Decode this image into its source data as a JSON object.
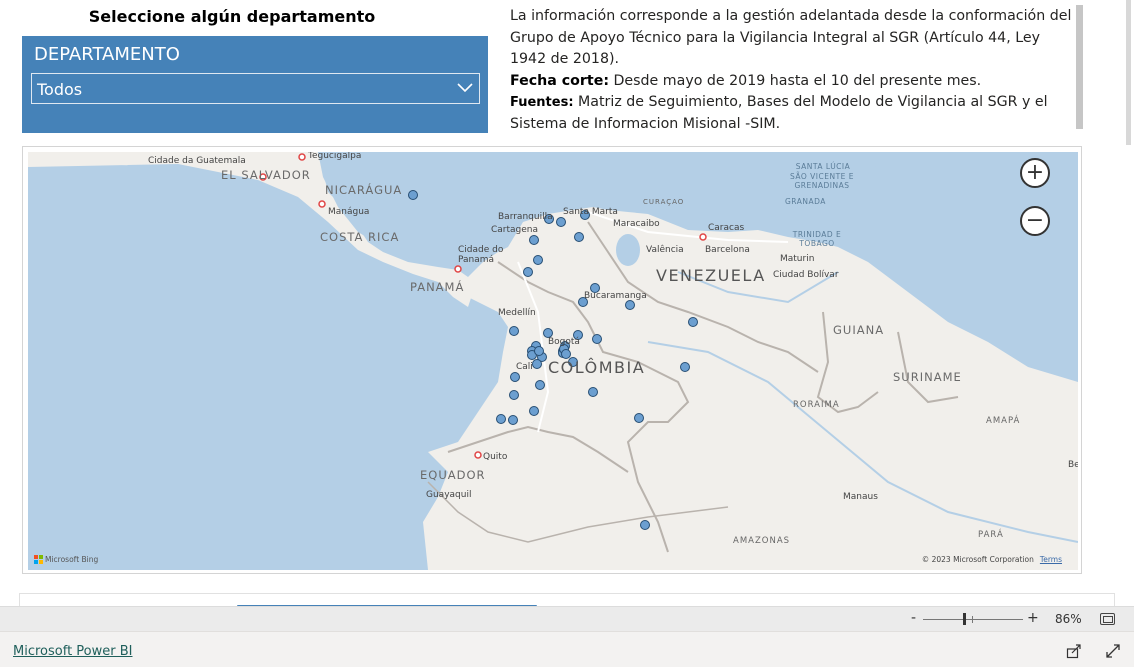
{
  "slicer": {
    "title": "Seleccione algún departamento",
    "header": "DEPARTAMENTO",
    "selected": "Todos",
    "accent": "#4582b8"
  },
  "info": {
    "p1": "La información corresponde a la gestión adelantada desde la conformación del Grupo de Apoyo Técnico para la Vigilancia Integral al SGR (Artículo 44, Ley 1942 de 2018).",
    "fecha_label": "Fecha corte:",
    "fecha_text": " Desde mayo de 2019 hasta el 10 del presente mes.",
    "fuentes_label": "Fuentes:",
    "fuentes_text": " Matriz de Seguimiento, Bases del Modelo de Vigilancia al SGR y el Sistema de Informacion Misional -SIM."
  },
  "map": {
    "zoom_in": "+",
    "zoom_out": "−",
    "attribution": "© 2023 Microsoft Corporation",
    "terms": "Terms",
    "bing": "Microsoft Bing",
    "labels": {
      "el_salvador": "EL SALVADOR",
      "guatemala": "Cidade da Guatemala",
      "tegucigalpa": "Tegucigalpa",
      "nicaragua": "NICARÁGUA",
      "managua": "Manágua",
      "costa_rica": "COSTA RICA",
      "panama_city": "Cidade do Panamá",
      "panama": "PANAMÁ",
      "barranquilla": "Barranquilla",
      "cartagena": "Cartagena",
      "santa_marta": "Santa Marta",
      "maracaibo": "Maracaibo",
      "curacao": "CURAÇAO",
      "caracas": "Caracas",
      "valencia": "Valência",
      "barcelona": "Barcelona",
      "maturin": "Maturin",
      "venezuela": "VENEZUELA",
      "ciudad_bolivar": "Ciudad Bolívar",
      "santa_lucia": "SANTA LÚCIA",
      "sao_vicente": "SÃO VICENTE E GRENADINAS",
      "granada": "GRANADA",
      "trinidad": "TRINIDAD E TOBAGO",
      "bucaramanga": "Bucaramanga",
      "medellin": "Medellín",
      "bogota": "Bogotá",
      "colombia": "COLÔMBIA",
      "cali": "Cali",
      "guiana": "GUIANA",
      "suriname": "SURINAME",
      "roraima": "RORAIMA",
      "amapa": "AMAPÁ",
      "quito": "Quito",
      "equador": "EQUADOR",
      "guayaquil": "Guayaquil",
      "manaus": "Manaus",
      "amazonas": "AMAZONAS",
      "para": "PARÁ",
      "be": "Be"
    },
    "point_color": "#6c9fd0",
    "point_count": 38
  },
  "zoombar": {
    "minus": "-",
    "plus": "+",
    "percent": "86%",
    "zoom_level": 0.45
  },
  "footer": {
    "link": "Microsoft Power BI"
  }
}
